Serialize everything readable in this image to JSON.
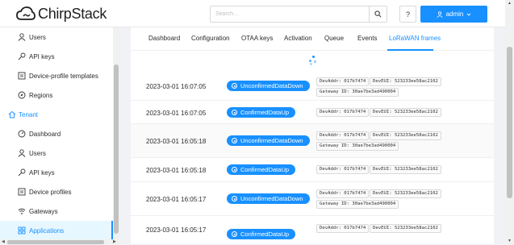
{
  "app": {
    "brand": "ChirpStack"
  },
  "header": {
    "search_placeholder": "Search...",
    "help_label": "?",
    "user_label": "admin"
  },
  "sidebar": {
    "items": [
      {
        "label": "Users",
        "icon": "user-icon",
        "level": "sub"
      },
      {
        "label": "API keys",
        "icon": "key-icon",
        "level": "sub"
      },
      {
        "label": "Device-profile templates",
        "icon": "profile-icon",
        "level": "sub"
      },
      {
        "label": "Regions",
        "icon": "compass-icon",
        "level": "sub"
      },
      {
        "label": "Tenant",
        "icon": "home-icon",
        "level": "top"
      },
      {
        "label": "Dashboard",
        "icon": "dashboard-icon",
        "level": "sub"
      },
      {
        "label": "Users",
        "icon": "user-icon",
        "level": "sub"
      },
      {
        "label": "API keys",
        "icon": "key-icon",
        "level": "sub"
      },
      {
        "label": "Device profiles",
        "icon": "profile-icon",
        "level": "sub"
      },
      {
        "label": "Gateways",
        "icon": "wifi-icon",
        "level": "sub"
      },
      {
        "label": "Applications",
        "icon": "appstore-icon",
        "level": "sub",
        "active": true
      }
    ]
  },
  "tabs": [
    {
      "label": "Dashboard"
    },
    {
      "label": "Configuration"
    },
    {
      "label": "OTAA keys"
    },
    {
      "label": "Activation"
    },
    {
      "label": "Queue"
    },
    {
      "label": "Events"
    },
    {
      "label": "LoRaWAN frames",
      "active": true
    }
  ],
  "frames": [
    {
      "time": "2023-03-01 16:07:05",
      "type": "UnconfirmedDataDown",
      "dev_addr": "DevAddr: 017b7474",
      "dev_eui": "DevEUI: 523233ee58ac2102",
      "gateway": "Gateway ID: 30ae7be3ad490004"
    },
    {
      "time": "2023-03-01 16:07:05",
      "type": "ConfirmedDataUp",
      "dev_addr": "DevAddr: 017b7474",
      "dev_eui": "DevEUI: 523233ee58ac2102",
      "gateway": ""
    },
    {
      "time": "2023-03-01 16:05:18",
      "type": "UnconfirmedDataDown",
      "dev_addr": "DevAddr: 017b7474",
      "dev_eui": "DevEUI: 523233ee58ac2102",
      "gateway": "Gateway ID: 30ae7be3ad490004"
    },
    {
      "time": "2023-03-01 16:05:18",
      "type": "ConfirmedDataUp",
      "dev_addr": "DevAddr: 017b7474",
      "dev_eui": "DevEUI: 523233ee58ac2102",
      "gateway": ""
    },
    {
      "time": "2023-03-01 16:05:17",
      "type": "UnconfirmedDataDown",
      "dev_addr": "DevAddr: 017b7474",
      "dev_eui": "DevEUI: 523233ee58ac2102",
      "gateway": "Gateway ID: 30ae7be3ad490004"
    },
    {
      "time": "2023-03-01 16:05:17",
      "type": "ConfirmedDataUp",
      "dev_addr": "DevAddr: 017b7474",
      "dev_eui": "DevEUI: 523233ee58ac2102",
      "gateway": ""
    }
  ],
  "colors": {
    "accent": "#1890ff",
    "active_bg": "#e6f7ff",
    "row_shade": "#fafafa"
  }
}
